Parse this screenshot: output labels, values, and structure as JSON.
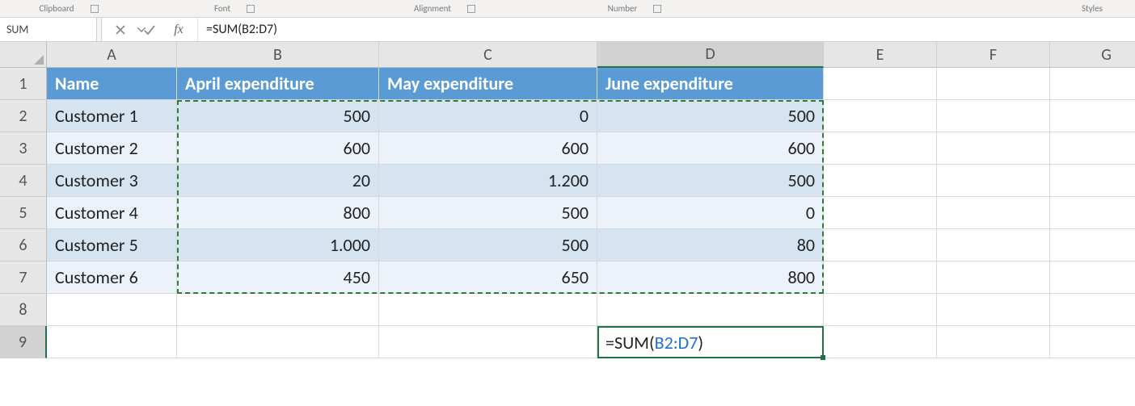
{
  "ribbon_groups": {
    "clipboard": "Clipboard",
    "font": "Font",
    "alignment": "Alignment",
    "number": "Number",
    "styles": "Styles"
  },
  "name_box": "SUM",
  "formula_bar": "=SUM(B2:D7)",
  "columns": [
    "A",
    "B",
    "C",
    "D",
    "E",
    "F",
    "G"
  ],
  "rows": [
    "1",
    "2",
    "3",
    "4",
    "5",
    "6",
    "7",
    "8",
    "9"
  ],
  "headers": {
    "A": "Name",
    "B": "April expenditure",
    "C": "May expenditure",
    "D": "June expenditure"
  },
  "data_rows": [
    {
      "name": "Customer 1",
      "b": "500",
      "c": "0",
      "d": "500"
    },
    {
      "name": "Customer 2",
      "b": "600",
      "c": "600",
      "d": "600"
    },
    {
      "name": "Customer 3",
      "b": "20",
      "c": "1.200",
      "d": "500"
    },
    {
      "name": "Customer 4",
      "b": "800",
      "c": "500",
      "d": "0"
    },
    {
      "name": "Customer 5",
      "b": "1.000",
      "c": "500",
      "d": "80"
    },
    {
      "name": "Customer 6",
      "b": "450",
      "c": "650",
      "d": "800"
    }
  ],
  "active_cell_formula": {
    "prefix": "=SUM(",
    "ref": "B2:D7",
    "suffix": ")"
  }
}
